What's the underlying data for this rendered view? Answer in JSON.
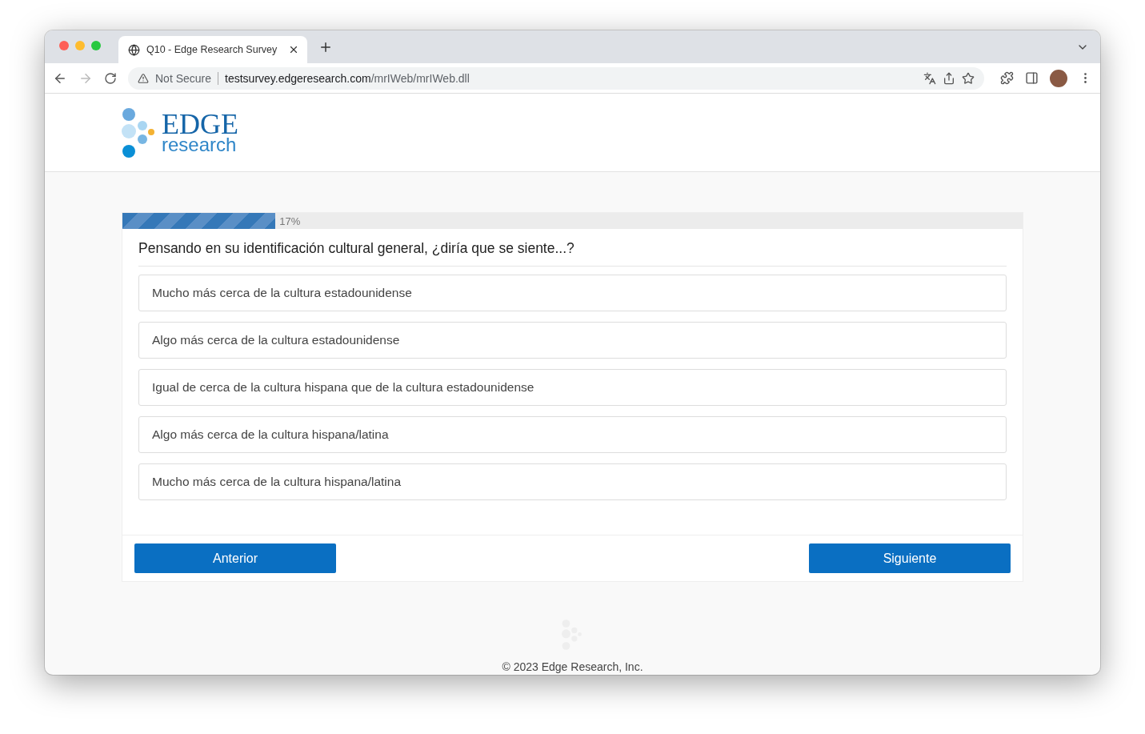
{
  "browser": {
    "tab_title": "Q10 - Edge Research Survey",
    "security": "Not Secure",
    "url_host": "testsurvey.edgeresearch.com",
    "url_path": "/mrIWeb/mrIWeb.dll"
  },
  "logo": {
    "word": "EDGE",
    "subword": "research"
  },
  "progress": {
    "level": 0.17,
    "reading": "17%"
  },
  "question": "Pensando en su identificación cultural general, ¿diría que se siente...?",
  "options": [
    {
      "label": "Mucho más cerca de la cultura estadounidense",
      "selected": false
    },
    {
      "label": "Algo más cerca de la cultura estadounidense",
      "selected": false
    },
    {
      "label": "Igual de cerca de la cultura hispana que de la cultura estadounidense",
      "selected": false
    },
    {
      "label": "Algo más cerca de la cultura hispana/latina",
      "selected": false
    },
    {
      "label": "Mucho más cerca de la cultura hispana/latina",
      "selected": false
    }
  ],
  "buttons": {
    "previous": "Anterior",
    "next": "Siguiente"
  },
  "footer": "© 2023 Edge Research, Inc."
}
